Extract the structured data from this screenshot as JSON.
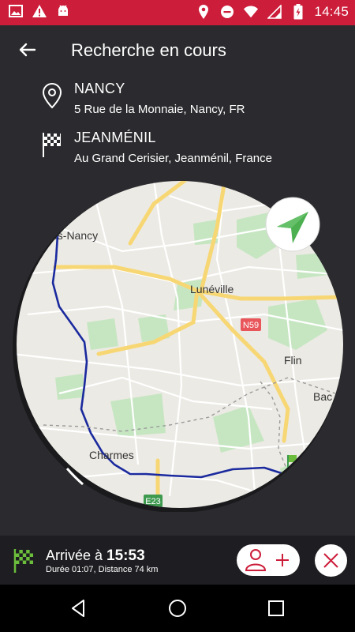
{
  "status_bar": {
    "time": "14:45",
    "left_icons": [
      "image-icon",
      "warning-icon",
      "android-icon"
    ],
    "right_icons": [
      "location-icon",
      "do-not-disturb-icon",
      "wifi-icon",
      "signal-icon",
      "battery-charging-icon"
    ]
  },
  "header": {
    "title": "Recherche en cours"
  },
  "origin": {
    "name": "NANCY",
    "address": "5 Rue de la Monnaie, Nancy, FR"
  },
  "destination": {
    "name": "JEANMÉNIL",
    "address": "Au Grand Cerisier, Jeanménil, France"
  },
  "map": {
    "labels": [
      "ès-Nancy",
      "Lunéville",
      "Flin",
      "Bac",
      "Charmes"
    ],
    "road_shields": [
      "N59",
      "E23"
    ],
    "colors": {
      "route": "#1a2a9e",
      "land": "#eceae4",
      "park": "#c6e6c2",
      "road_major": "#f7d774",
      "road_minor": "#ffffff",
      "shield_red": "#e8555a",
      "shield_green": "#3e9a4f"
    }
  },
  "arrival": {
    "label_prefix": "Arrivée à",
    "time": "15:53",
    "details": "Durée 01:07, Distance 74 km"
  },
  "colors": {
    "accent": "#cc1d3a",
    "background": "#2b2b2f",
    "bottom_bar": "#1e1e22",
    "flag_green": "#6bbd3b"
  }
}
